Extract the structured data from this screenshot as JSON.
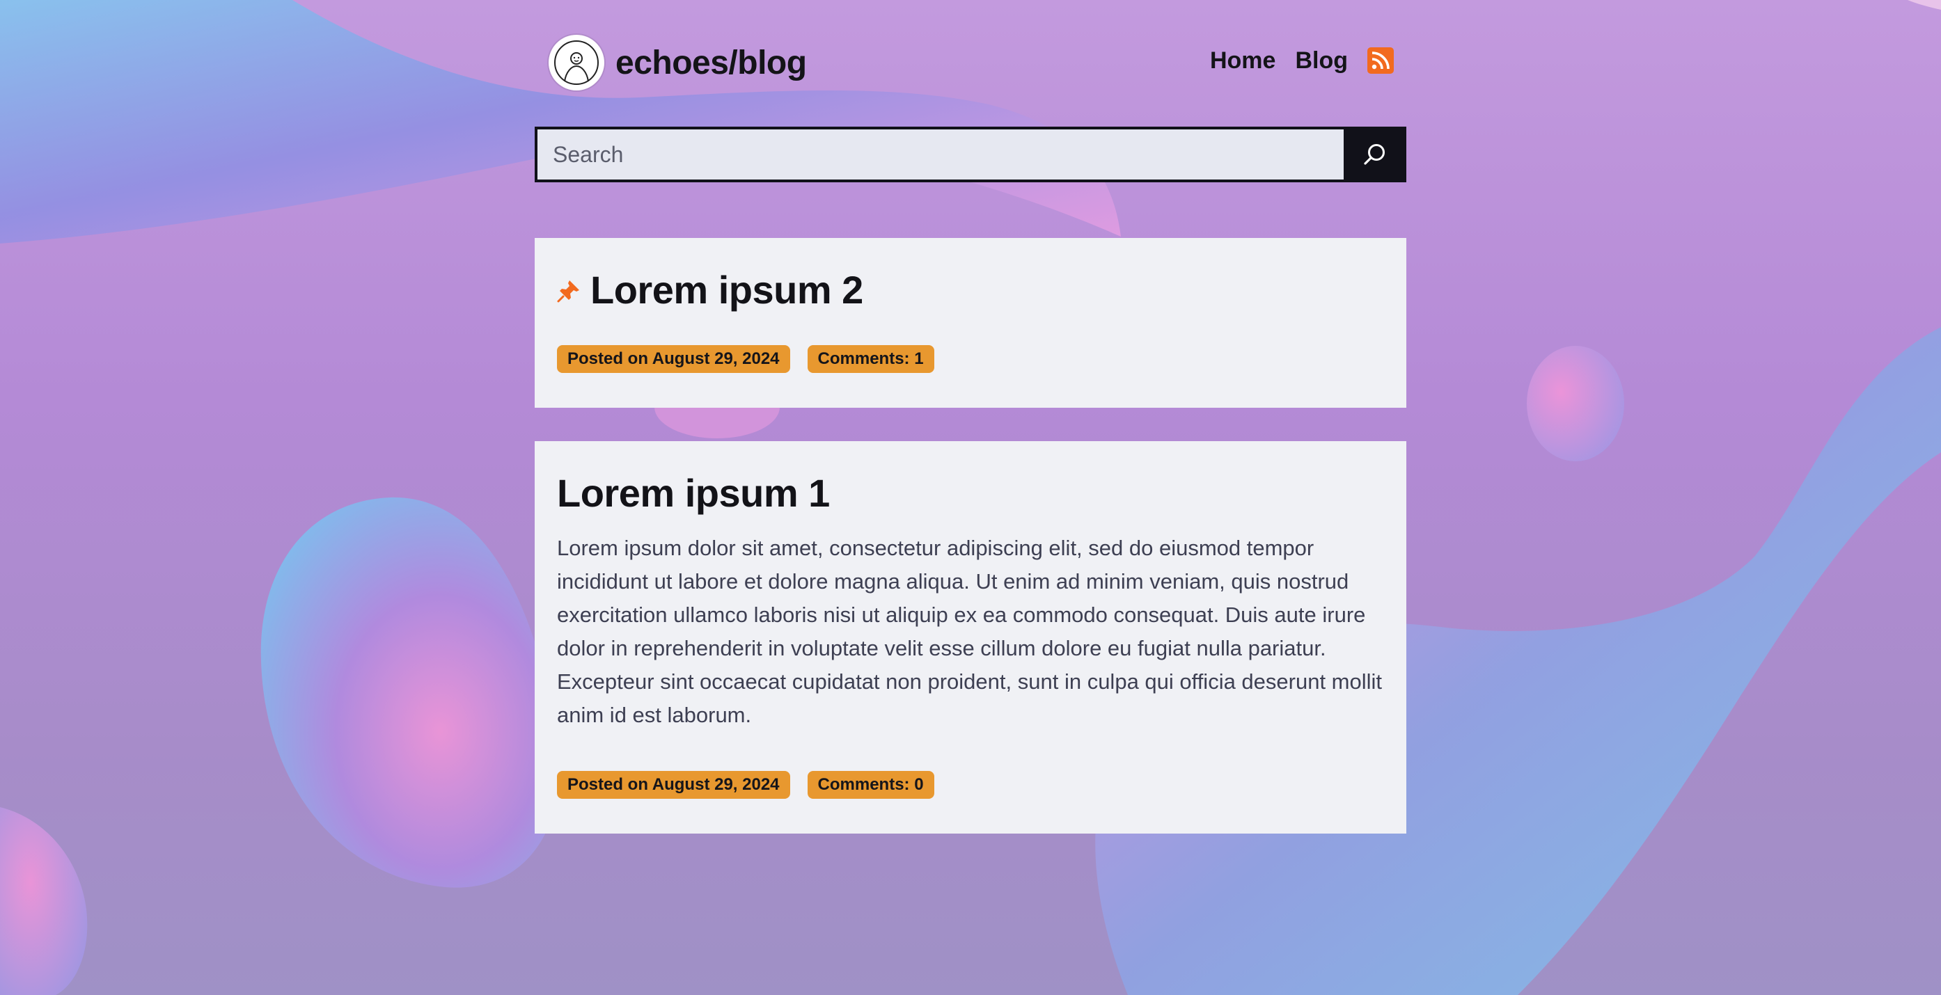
{
  "site": {
    "title": "echoes/blog"
  },
  "nav": {
    "items": [
      {
        "label": "Home"
      },
      {
        "label": "Blog"
      }
    ]
  },
  "search": {
    "placeholder": "Search",
    "value": ""
  },
  "posts": [
    {
      "title": "Lorem ipsum 2",
      "pinned": true,
      "posted": "Posted on August 29, 2024",
      "comments": "Comments: 1"
    },
    {
      "title": "Lorem ipsum 1",
      "pinned": false,
      "excerpt": "Lorem ipsum dolor sit amet, consectetur adipiscing elit, sed do eiusmod tempor incididunt ut labore et dolore magna aliqua. Ut enim ad minim veniam, quis nostrud exercitation ullamco laboris nisi ut aliquip ex ea commodo consequat. Duis aute irure dolor in reprehenderit in voluptate velit esse cillum dolore eu fugiat nulla pariatur. Excepteur sint occaecat cupidatat non proident, sunt in culpa qui officia deserunt mollit anim id est laborum.",
      "posted": "Posted on August 29, 2024",
      "comments": "Comments: 0"
    }
  ],
  "icons": {
    "avatar": "avatar-icon",
    "rss": "rss-icon",
    "search": "search-icon",
    "pin": "pin-icon"
  },
  "colors": {
    "accent": "#e8982f",
    "rss": "#f26a1f",
    "pin": "#f26a1f",
    "dark": "#111119",
    "card": "#f0f1f5"
  }
}
